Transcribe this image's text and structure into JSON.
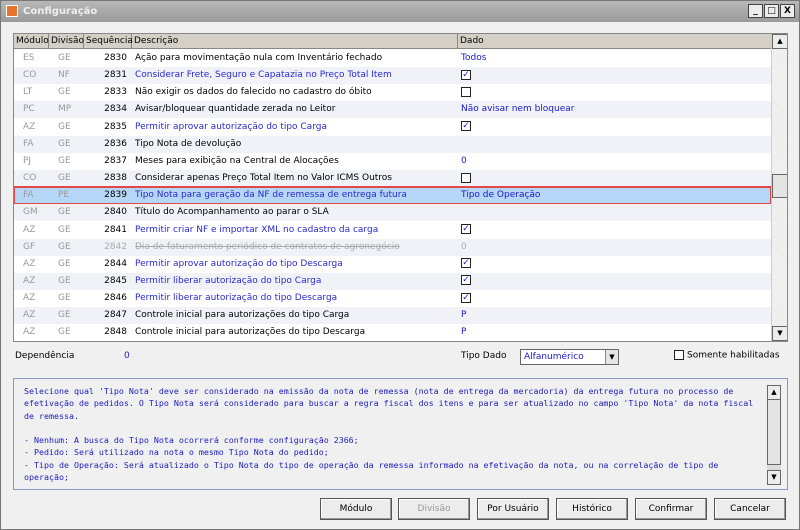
{
  "window": {
    "title": "Configuração",
    "minimize": "_",
    "maximize": "□",
    "close": "X"
  },
  "grid": {
    "headers": [
      "Módulo",
      "Divisão",
      "Sequência",
      "Descrição",
      "Dado"
    ],
    "rows": [
      {
        "modulo": "ES",
        "divisao": "GE",
        "seq": "2830",
        "desc": "Ação para movimentação nula com Inventário fechado",
        "dado": "Todos",
        "type": "text",
        "style": "normal"
      },
      {
        "modulo": "CO",
        "divisao": "NF",
        "seq": "2831",
        "desc": "Considerar Frete, Seguro e Capatazia no Preço Total Item",
        "dado": "checked",
        "type": "check",
        "style": "blue"
      },
      {
        "modulo": "LT",
        "divisao": "GE",
        "seq": "2833",
        "desc": "Não exigir os dados do falecido no cadastro do óbito",
        "dado": "unchecked",
        "type": "check",
        "style": "normal"
      },
      {
        "modulo": "PC",
        "divisao": "MP",
        "seq": "2834",
        "desc": "Avisar/bloquear quantidade zerada no Leitor",
        "dado": "Não avisar nem bloquear",
        "type": "text",
        "style": "normal"
      },
      {
        "modulo": "AZ",
        "divisao": "GE",
        "seq": "2835",
        "desc": "Permitir aprovar autorização do tipo Carga",
        "dado": "checked",
        "type": "check",
        "style": "blue"
      },
      {
        "modulo": "FA",
        "divisao": "GE",
        "seq": "2836",
        "desc": "Tipo Nota de devolução",
        "dado": "",
        "type": "text",
        "style": "normal"
      },
      {
        "modulo": "PJ",
        "divisao": "GE",
        "seq": "2837",
        "desc": "Meses para exibição na Central de Alocações",
        "dado": "0",
        "type": "text",
        "style": "normal"
      },
      {
        "modulo": "CO",
        "divisao": "GE",
        "seq": "2838",
        "desc": "Considerar apenas Preço Total Item no Valor ICMS Outros",
        "dado": "unchecked",
        "type": "check",
        "style": "normal"
      },
      {
        "modulo": "FA",
        "divisao": "PE",
        "seq": "2839",
        "desc": "Tipo Nota para geração da NF de remessa de entrega futura",
        "dado": "Tipo de Operação",
        "type": "text",
        "style": "blue",
        "selected": true
      },
      {
        "modulo": "GM",
        "divisao": "GE",
        "seq": "2840",
        "desc": "Título do Acompanhamento ao parar o SLA",
        "dado": "",
        "type": "text",
        "style": "normal"
      },
      {
        "modulo": "AZ",
        "divisao": "GE",
        "seq": "2841",
        "desc": "Permitir criar NF e importar XML no cadastro da carga",
        "dado": "checked",
        "type": "check",
        "style": "blue"
      },
      {
        "modulo": "GF",
        "divisao": "GE",
        "seq": "2842",
        "desc": "Dia de faturamento periódico de contratos de agronegócio",
        "dado": "0",
        "type": "text",
        "style": "strike"
      },
      {
        "modulo": "AZ",
        "divisao": "GE",
        "seq": "2844",
        "desc": "Permitir aprovar autorização do tipo Descarga",
        "dado": "checked",
        "type": "check",
        "style": "blue"
      },
      {
        "modulo": "AZ",
        "divisao": "GE",
        "seq": "2845",
        "desc": "Permitir liberar autorização do tipo Carga",
        "dado": "checked",
        "type": "check",
        "style": "blue"
      },
      {
        "modulo": "AZ",
        "divisao": "GE",
        "seq": "2846",
        "desc": "Permitir liberar autorização do tipo Descarga",
        "dado": "checked",
        "type": "check",
        "style": "blue"
      },
      {
        "modulo": "AZ",
        "divisao": "GE",
        "seq": "2847",
        "desc": "Controle inicial para autorizações do tipo Carga",
        "dado": "P",
        "type": "text",
        "style": "normal"
      },
      {
        "modulo": "AZ",
        "divisao": "GE",
        "seq": "2848",
        "desc": "Controle inicial para autorizações do tipo Descarga",
        "dado": "P",
        "type": "text",
        "style": "normal"
      }
    ]
  },
  "footer": {
    "dependencia_label": "Dependência",
    "dependencia_value": "0",
    "tipo_dado_label": "Tipo Dado",
    "tipo_dado_value": "Alfanumérico",
    "somente_label": "Somente habilitadas"
  },
  "description": "Selecione qual 'Tipo Nota' deve ser considerado na emissão da nota de remessa (nota de entrega da mercadoria) da entrega futura no processo de efetivação de pedidos. O Tipo Nota será considerado para buscar a regra fiscal dos itens e para ser atualizado no campo 'Tipo Nota' da nota fiscal de remessa.\n\n- Nenhum: A busca do Tipo Nota ocorrerá conforme configuração 2366;\n- Pedido: Será utilizado na nota o mesmo Tipo Nota do pedido;\n- Tipo de Operação: Será atualizado o Tipo Nota do tipo de operação da remessa informado na efetivação da nota, ou na correlação de tipo de operação;",
  "buttons": {
    "modulo": "Módulo",
    "divisao": "Divisão",
    "por_usuario": "Por Usuário",
    "historico": "Histórico",
    "confirmar": "Confirmar",
    "cancelar": "Cancelar"
  }
}
